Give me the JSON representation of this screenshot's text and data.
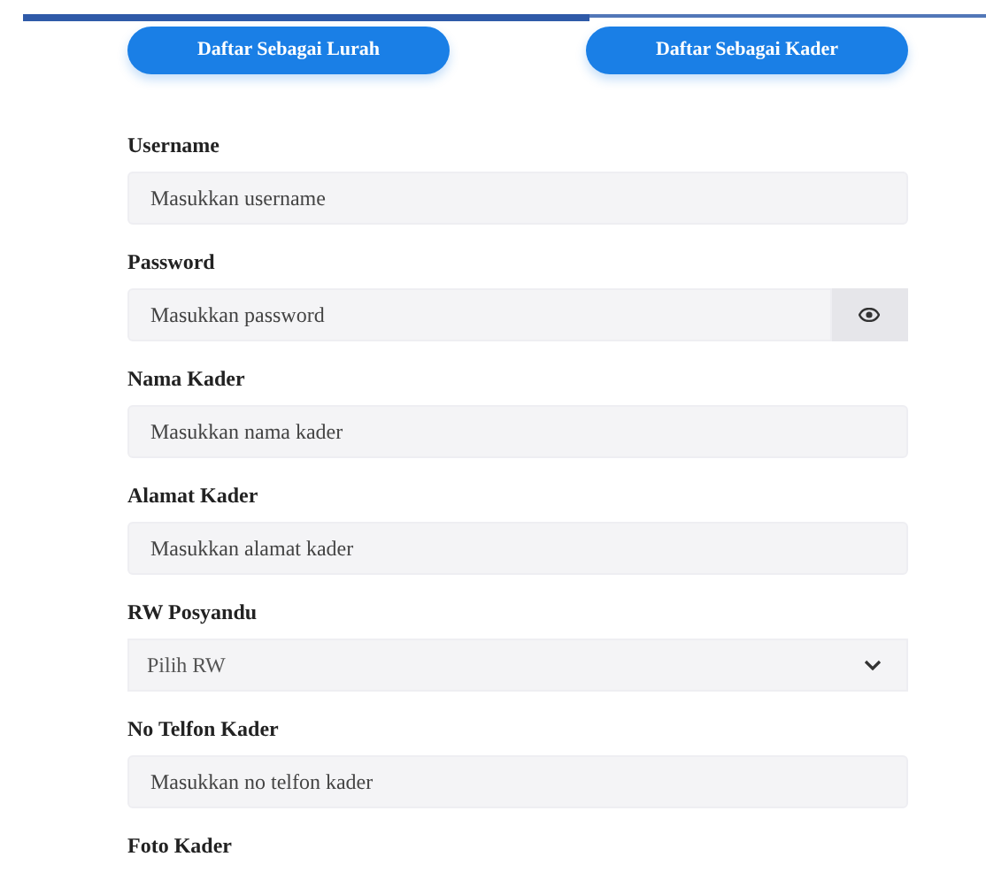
{
  "role_buttons": [
    {
      "label": "Daftar Sebagai Lurah"
    },
    {
      "label": "Daftar Sebagai Kader"
    }
  ],
  "fields": [
    {
      "kind": "text",
      "label": "Username",
      "placeholder": "Masukkan username"
    },
    {
      "kind": "password",
      "label": "Password",
      "placeholder": "Masukkan password"
    },
    {
      "kind": "text",
      "label": "Nama Kader",
      "placeholder": "Masukkan nama kader"
    },
    {
      "kind": "text",
      "label": "Alamat Kader",
      "placeholder": "Masukkan alamat kader"
    },
    {
      "kind": "select",
      "label": "RW Posyandu",
      "value": "Pilih RW"
    },
    {
      "kind": "text",
      "label": "No Telfon Kader",
      "placeholder": "Masukkan no telfon kader"
    },
    {
      "kind": "heading",
      "label": "Foto Kader"
    }
  ]
}
